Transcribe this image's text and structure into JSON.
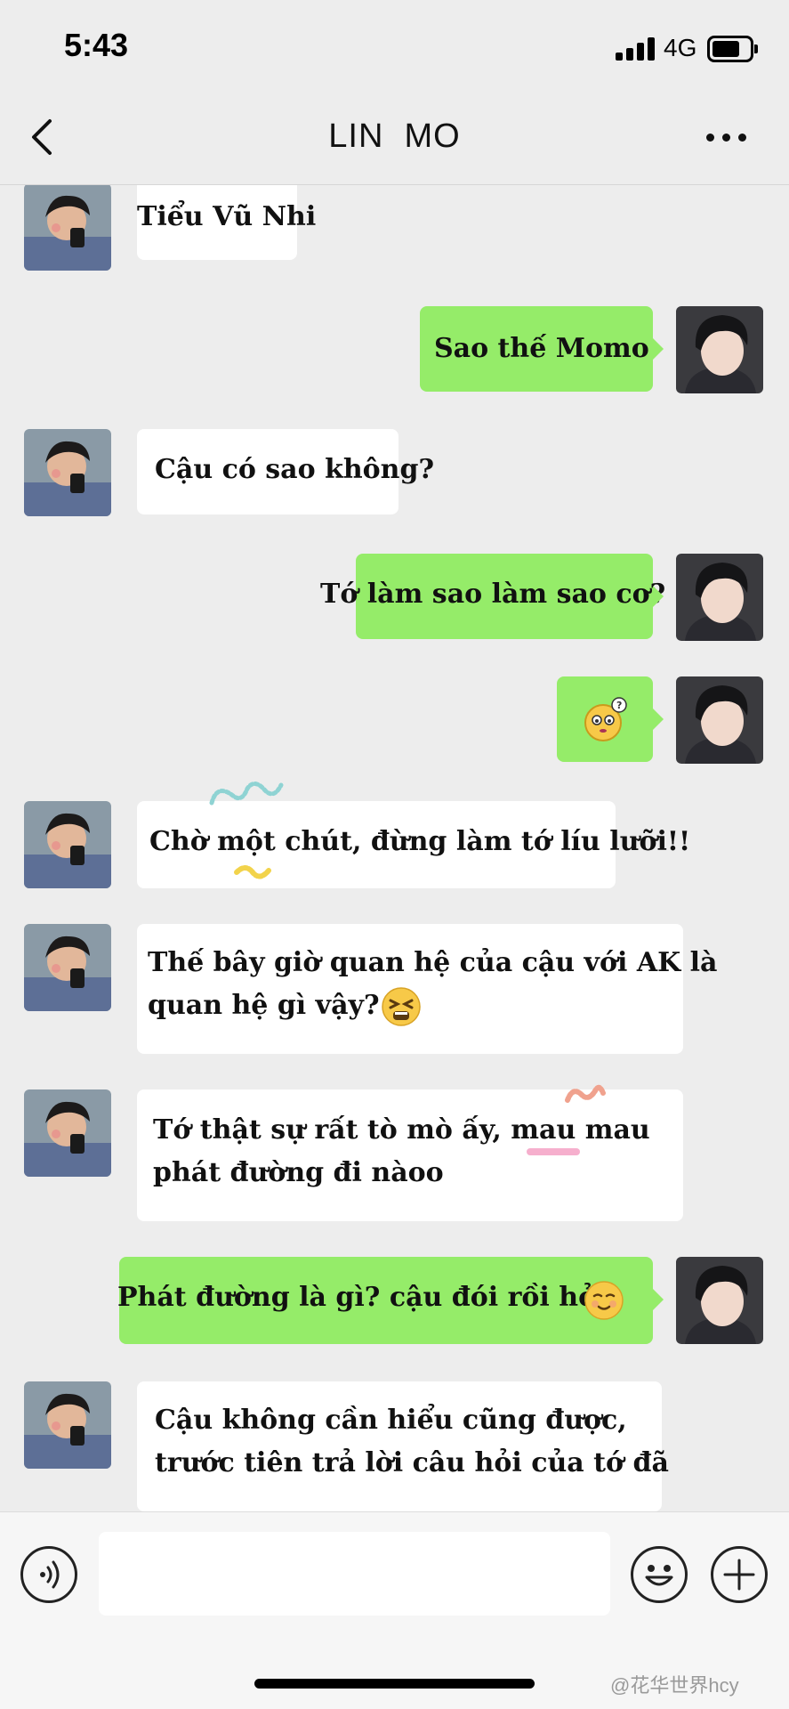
{
  "status_bar": {
    "time": "5:43",
    "network": "4G"
  },
  "nav": {
    "title": "LIN  MO",
    "back_icon": "chevron-left-icon",
    "more_icon": "ellipsis-icon"
  },
  "messages": [
    {
      "side": "in",
      "text": "Tiểu Vũ Nhi"
    },
    {
      "side": "out",
      "text": "Sao thế Momo"
    },
    {
      "side": "in",
      "text": "Cậu có sao không?"
    },
    {
      "side": "out",
      "text": "Tớ làm sao làm sao cơ?"
    },
    {
      "side": "out",
      "sticker": "confused-face-sticker"
    },
    {
      "side": "in",
      "text": "Chờ một chút, đừng làm tớ líu lưỡi!!"
    },
    {
      "side": "in",
      "line1": "Thế bây giờ quan hệ của cậu với AK là",
      "line2": "quan hệ gì vậy?",
      "emoji": "tired-face-emoji"
    },
    {
      "side": "in",
      "line1": "Tớ thật sự rất tò mò ấy, mau mau",
      "line2": "phát đường đi nàoo"
    },
    {
      "side": "out",
      "text": "Phát đường là gì? cậu đói rồi hỏ?",
      "emoji": "smiling-face-emoji"
    },
    {
      "side": "in",
      "line1": "Cậu không cần hiểu cũng được,",
      "line2": "trước tiên trả lời câu hỏi của tớ đã"
    }
  ],
  "input_bar": {
    "voice_icon": "voice-icon",
    "emoji_icon": "emoji-icon",
    "add_icon": "plus-icon"
  },
  "watermark": "@花华世界hcy",
  "colors": {
    "background": "#ededed",
    "outgoing_bubble": "#95ec69",
    "incoming_bubble": "#ffffff"
  }
}
